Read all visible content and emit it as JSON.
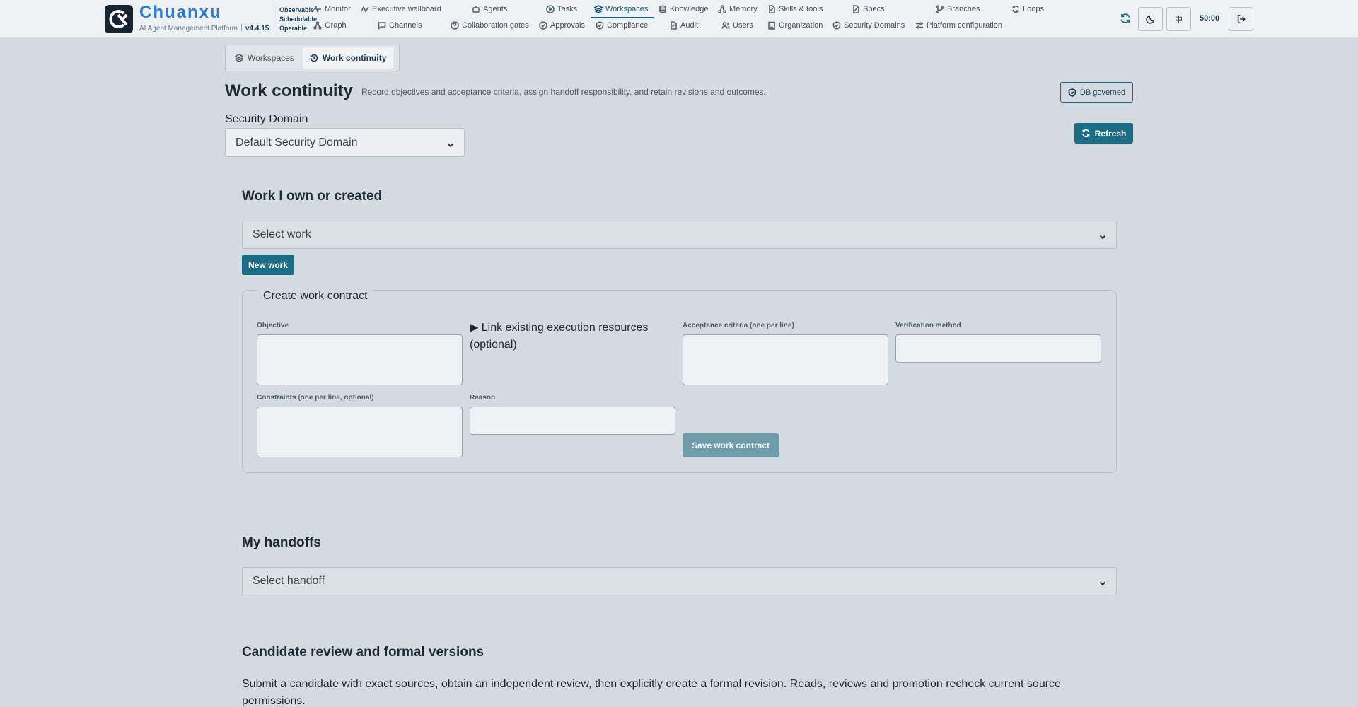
{
  "brand": {
    "name": "Chuanxu",
    "subtitle": "AI Agent Management Platform",
    "version": "v4.4.15",
    "tags": [
      "Observable",
      "Schedulable",
      "Operable"
    ]
  },
  "nav": {
    "row1": [
      {
        "label": "Monitor",
        "icon": "monitor-icon"
      },
      {
        "label": "Executive wallboard",
        "icon": "pulse-icon"
      },
      {
        "label": "Agents",
        "icon": "robot-icon"
      },
      {
        "label": "Tasks",
        "icon": "play-circle-icon"
      },
      {
        "label": "Workspaces",
        "icon": "layers-icon",
        "active": true
      },
      {
        "label": "Knowledge",
        "icon": "database-icon"
      },
      {
        "label": "Memory",
        "icon": "nodes-icon"
      },
      {
        "label": "Skills & tools",
        "icon": "tool-file-icon"
      },
      {
        "label": "Specs",
        "icon": "spec-file-icon"
      },
      {
        "label": "Branches",
        "icon": "branch-icon"
      },
      {
        "label": "Loops",
        "icon": "loop-icon"
      }
    ],
    "row2": [
      {
        "label": "Graph",
        "icon": "graph-icon"
      },
      {
        "label": "Channels",
        "icon": "chat-icon"
      },
      {
        "label": "Collaboration gates",
        "icon": "question-circle-icon"
      },
      {
        "label": "Approvals",
        "icon": "check-circle-icon"
      },
      {
        "label": "Compliance",
        "icon": "shield-check-icon"
      },
      {
        "label": "Audit",
        "icon": "audit-file-icon"
      },
      {
        "label": "Users",
        "icon": "users-icon"
      },
      {
        "label": "Organization",
        "icon": "building-icon"
      },
      {
        "label": "Security Domains",
        "icon": "shield-icon"
      },
      {
        "label": "Platform configuration",
        "icon": "sliders-icon"
      }
    ]
  },
  "toolbar": {
    "lang_label": "中",
    "session_timer": "50:00"
  },
  "tabs": [
    {
      "label": "Workspaces",
      "icon": "layers-icon"
    },
    {
      "label": "Work continuity",
      "icon": "history-icon",
      "active": true
    }
  ],
  "page": {
    "title": "Work continuity",
    "description": "Record objectives and acceptance criteria, assign handoff responsibility, and retain revisions and outcomes.",
    "badge": "DB governed",
    "refresh_label": "Refresh"
  },
  "security_domain": {
    "label": "Security Domain",
    "selected": "Default Security Domain"
  },
  "work": {
    "title": "Work I own or created",
    "select_placeholder": "Select work",
    "new_label": "New work"
  },
  "contract": {
    "legend": "Create work contract",
    "objective_label": "Objective",
    "link_label": "Link existing execution resources (optional)",
    "acceptance_label": "Acceptance criteria (one per line)",
    "verification_label": "Verification method",
    "constraints_label": "Constraints (one per line, optional)",
    "reason_label": "Reason",
    "save_label": "Save work contract"
  },
  "handoffs": {
    "title": "My handoffs",
    "select_placeholder": "Select handoff"
  },
  "candidate": {
    "title": "Candidate review and formal versions",
    "description": "Submit a candidate with exact sources, obtain an independent review, then explicitly create a formal revision. Reads, reviews and promotion recheck current source permissions."
  },
  "colors": {
    "accent": "#1a6e86",
    "brand": "#2b7bd4",
    "background": "#d4dbe0"
  }
}
